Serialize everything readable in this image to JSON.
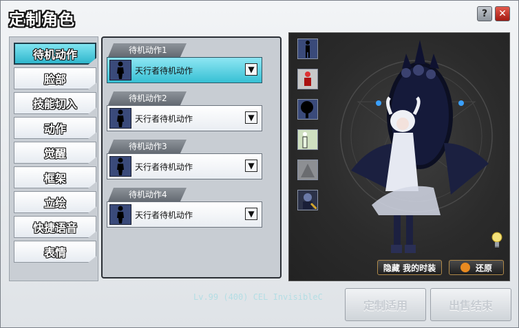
{
  "window": {
    "title": "定制角色",
    "help": "?",
    "close": "✕"
  },
  "categories": [
    {
      "label": "待机动作",
      "active": true
    },
    {
      "label": "脸部",
      "active": false
    },
    {
      "label": "技能切入",
      "active": false
    },
    {
      "label": "动作",
      "active": false
    },
    {
      "label": "觉醒",
      "active": false
    },
    {
      "label": "框架",
      "active": false
    },
    {
      "label": "立绘",
      "active": false
    },
    {
      "label": "快捷语音",
      "active": false
    },
    {
      "label": "表情",
      "active": false
    }
  ],
  "slots": [
    {
      "tab": "待机动作1",
      "value": "天行者待机动作",
      "active": true
    },
    {
      "tab": "待机动作2",
      "value": "天行者待机动作",
      "active": false
    },
    {
      "tab": "待机动作3",
      "value": "天行者待机动作",
      "active": false
    },
    {
      "tab": "待机动作4",
      "value": "天行者待机动作",
      "active": false
    }
  ],
  "dropdown_glyph": "▼",
  "preview": {
    "thumbnails": [
      "standing-silhouette-icon",
      "red-figure-icon",
      "dark-figure-icon",
      "green-figure-icon",
      "gray-figure-icon",
      "character-portrait-icon"
    ],
    "hide_label": "隐藏 我的时装",
    "restore_label": "还原"
  },
  "bottom": {
    "apply_label": "定制适用",
    "sell_label": "出售结束",
    "ghost_text": "Lv.99 (400) CEL InvisibleC"
  },
  "colors": {
    "accent": "#2fb6cc",
    "panel": "#c8cdd3",
    "preview_bg": "#2b2b2b"
  }
}
